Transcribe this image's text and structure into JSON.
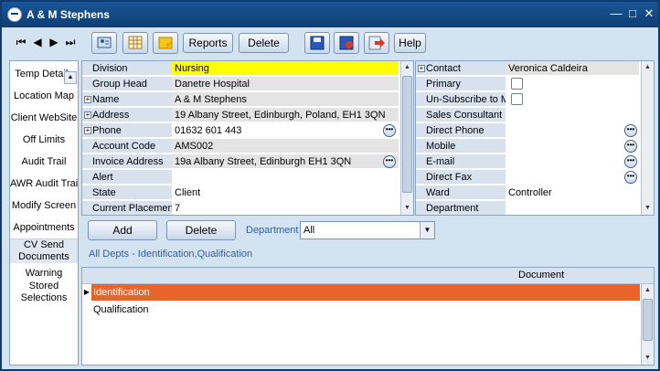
{
  "window": {
    "title": "A & M Stephens"
  },
  "toolbar": {
    "reports_label": "Reports",
    "delete_label": "Delete",
    "help_label": "Help"
  },
  "sidebar": {
    "items": [
      {
        "label": "Temp Details"
      },
      {
        "label": "Location Map"
      },
      {
        "label": "Client WebSite"
      },
      {
        "label": "Off Limits"
      },
      {
        "label": "Audit Trail"
      },
      {
        "label": "AWR Audit Trail"
      },
      {
        "label": "Modify Screen"
      },
      {
        "label": "Appointments"
      },
      {
        "label": "CV Send Documents"
      },
      {
        "label": "Warning"
      },
      {
        "label": "Stored Selections"
      }
    ]
  },
  "left_fields": [
    {
      "label": "Division",
      "value": "Nursing"
    },
    {
      "label": "Group Head",
      "value": "Danetre Hospital"
    },
    {
      "label": "Name",
      "value": "A & M Stephens"
    },
    {
      "label": "Address",
      "value": "19 Albany Street, Edinburgh, Poland, EH1 3QN"
    },
    {
      "label": "Phone",
      "value": "01632 601 443"
    },
    {
      "label": "Account Code",
      "value": "AMS002"
    },
    {
      "label": "Invoice Address",
      "value": "19a Albany Street, Edinburgh EH1 3QN"
    },
    {
      "label": "Alert",
      "value": ""
    },
    {
      "label": "State",
      "value": "Client"
    },
    {
      "label": "Current Placement",
      "value": "7"
    }
  ],
  "right_fields": [
    {
      "label": "Contact",
      "value": "Veronica Caldeira"
    },
    {
      "label": "Primary",
      "value": ""
    },
    {
      "label": "Un-Subscribe to M",
      "value": ""
    },
    {
      "label": "Sales Consultant",
      "value": ""
    },
    {
      "label": "Direct Phone",
      "value": ""
    },
    {
      "label": "Mobile",
      "value": ""
    },
    {
      "label": "E-mail",
      "value": ""
    },
    {
      "label": "Direct Fax",
      "value": ""
    },
    {
      "label": "Ward",
      "value": "Controller"
    },
    {
      "label": "Department",
      "value": ""
    }
  ],
  "actions": {
    "add_label": "Add",
    "delete_label": "Delete"
  },
  "department": {
    "label": "Department",
    "selected": "All"
  },
  "filter_summary": "All Depts - Identification,Qualification",
  "documents": {
    "column": "Document",
    "rows": [
      {
        "value": "Identification",
        "selected": true
      },
      {
        "value": "Qualification",
        "selected": false
      }
    ]
  },
  "colors": {
    "title_bar": "#0e3e73",
    "highlight": "#ffff00",
    "selected_row": "#e8642a"
  }
}
